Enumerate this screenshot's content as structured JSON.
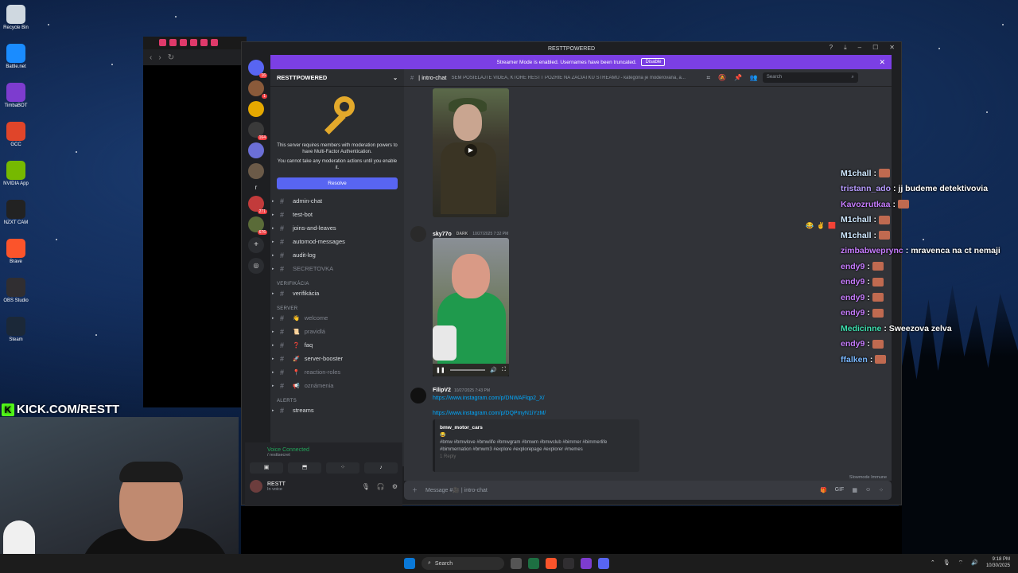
{
  "desktop": {
    "icons": [
      {
        "label": "Recycle Bin",
        "icon": "recycle-bin-icon",
        "color": "#cfd8e0"
      },
      {
        "label": "Battle.net",
        "icon": "battlenet-icon",
        "color": "#1a8cff"
      },
      {
        "label": "TimbaBOT",
        "icon": "bot-icon",
        "color": "#7d3ccf"
      },
      {
        "label": "GCC",
        "icon": "gcc-icon",
        "color": "#e0452a"
      },
      {
        "label": "NVIDIA App",
        "icon": "nvidia-icon",
        "color": "#76b900"
      },
      {
        "label": "NZXT CAM",
        "icon": "nzxt-icon",
        "color": "#222"
      },
      {
        "label": "Brave",
        "icon": "brave-icon",
        "color": "#fb542b"
      },
      {
        "label": "OBS Studio",
        "icon": "obs-icon",
        "color": "#302e31"
      },
      {
        "label": "Steam",
        "icon": "steam-icon",
        "color": "#1b2838"
      }
    ]
  },
  "discord": {
    "window_title": "RESTTPOWERED",
    "banner": {
      "text": "Streamer Mode is enabled. Usernames have been truncated.",
      "button": "Disable"
    },
    "guild_badges": [
      "16",
      "1",
      "164",
      "271",
      "676"
    ],
    "guild_letter": "r",
    "server_name": "RESTTPOWERED",
    "mfa": {
      "line1": "This server requires members with moderation powers to have Multi-Factor Authentication.",
      "line2": "You cannot take any moderation actions until you enable it.",
      "button": "Resolve"
    },
    "channels_top": [
      {
        "name": "admin-chat",
        "muted": false
      },
      {
        "name": "test-bot",
        "muted": false
      },
      {
        "name": "joins-and-leaves",
        "muted": false
      },
      {
        "name": "automod-messages",
        "muted": false
      },
      {
        "name": "audit-log",
        "muted": false
      },
      {
        "name": "SECRETOVKA",
        "muted": true
      }
    ],
    "cat_verify": "VERIFIKÁCIA",
    "channels_verify": [
      {
        "name": "verifikácia"
      }
    ],
    "cat_server": "SERVER",
    "channels_server": [
      {
        "emoji": "👋",
        "name": "welcome",
        "muted": true
      },
      {
        "emoji": "📜",
        "name": "pravidlá",
        "muted": true
      },
      {
        "emoji": "❓",
        "name": "faq",
        "muted": false
      },
      {
        "emoji": "🚀",
        "name": "server-booster",
        "muted": false
      },
      {
        "emoji": "📍",
        "name": "reaction-roles",
        "muted": true
      },
      {
        "emoji": "📢",
        "name": "oznámenia",
        "muted": true
      }
    ],
    "cat_alerts": "ALERTS",
    "channels_alerts": [
      {
        "name": "streams"
      }
    ],
    "voice": {
      "status": "Voice Connected",
      "channel": "/ resttsecret"
    },
    "user": {
      "name": "RESTT",
      "status": "In voice"
    },
    "chat_header": {
      "channel": "| intro-chat",
      "topic": "SEM POSIELAJTE VIDEÁ, KTORÉ RESTT POZRIE NA ZAČIATKU STREAMU - kategória je moderovaná, a...",
      "search_placeholder": "Search"
    },
    "messages": [
      {
        "author": "sky77o",
        "tag": "DARK",
        "time": "10/27/2025 7:32 PM"
      },
      {
        "author": "FilipV2",
        "time": "10/27/2025 7:43 PM",
        "link1": "https://www.instagram.com/p/DNWAFlqp2_X/",
        "link2": "https://www.instagram.com/p/DQPmyN1iYzM/",
        "embed_title": "bmw_motor_cars",
        "embed_emoji": "😂",
        "embed_text": "#bmw #bmwlove #bmwlife #bmwgram #bmwm #bmwclub #bimmer #bimmerlife #bimmernation #bmwm3 #explore #explorepage #explorer #memes",
        "embed_more": "1 Reply"
      }
    ],
    "slowmode": "Slowmode Immune",
    "composer_placeholder": "Message #🎥 | intro-chat"
  },
  "stream_chat": [
    {
      "user": "M1chall",
      "color": "#cfe8ff",
      "text": ":"
    },
    {
      "user": "tristann_ado",
      "color": "#b79cff",
      "text": ": jj budeme detektivovia"
    },
    {
      "user": "Kavozrutkaa",
      "color": "#c77dff",
      "text": ":"
    },
    {
      "user": "M1chall",
      "color": "#cfe8ff",
      "text": ":"
    },
    {
      "user": "M1chall",
      "color": "#cfe8ff",
      "text": ":"
    },
    {
      "user": "zimbabweprync",
      "color": "#c77dff",
      "text": ": mravenca na ct nemaji"
    },
    {
      "user": "endy9",
      "color": "#c77dff",
      "text": ":"
    },
    {
      "user": "endy9",
      "color": "#c77dff",
      "text": ":"
    },
    {
      "user": "endy9",
      "color": "#c77dff",
      "text": ":"
    },
    {
      "user": "endy9",
      "color": "#c77dff",
      "text": ":"
    },
    {
      "user": "Medicinne",
      "color": "#3ee0b0",
      "text": ": Sweezova zelva"
    },
    {
      "user": "endy9",
      "color": "#c77dff",
      "text": ":"
    },
    {
      "user": "ffalken",
      "color": "#7ab8ff",
      "text": ":"
    }
  ],
  "kick_label": "KICK.COM/RESTT",
  "taskbar": {
    "search": "Search",
    "time": "9:18 PM",
    "date": "10/30/2025"
  }
}
